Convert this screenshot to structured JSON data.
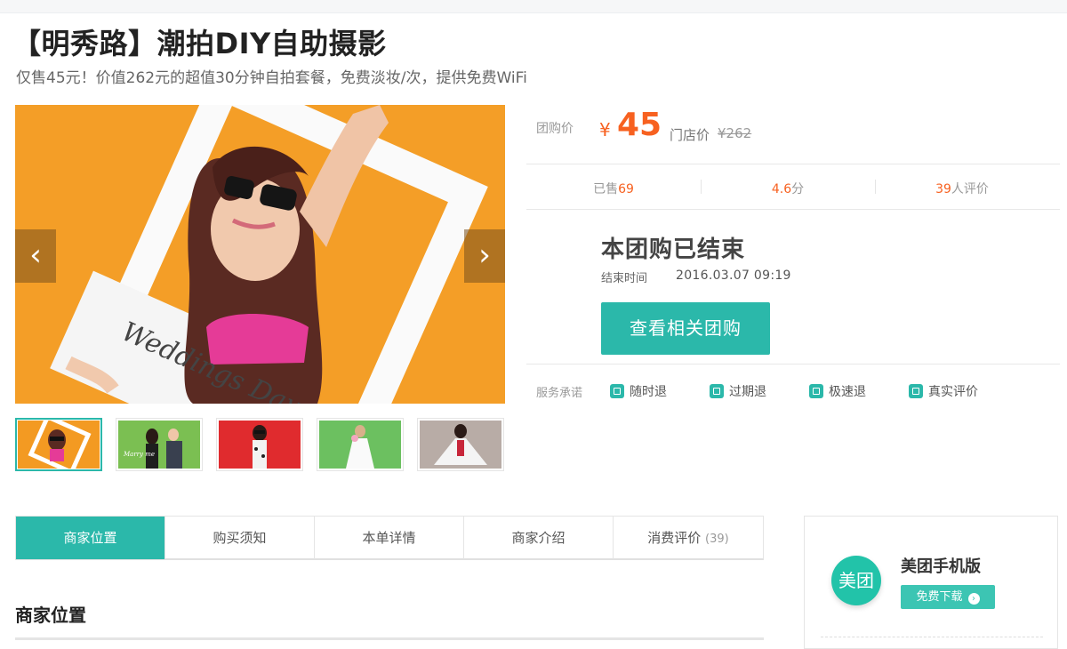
{
  "deal": {
    "title": "【明秀路】潮拍DIY自助摄影",
    "subtitle": "仅售45元！价值262元的超值30分钟自拍套餐，免费淡妆/次，提供免费WiFi"
  },
  "gallery": {
    "photo_text": "Weddings Day",
    "prev_glyph": "‹",
    "next_glyph": "›",
    "thumbnails": [
      {
        "caption": "",
        "active": true
      },
      {
        "caption": "Marry me",
        "active": false
      },
      {
        "caption": "",
        "active": false
      },
      {
        "caption": "",
        "active": false
      },
      {
        "caption": "",
        "active": false
      }
    ]
  },
  "price": {
    "label": "团购价",
    "currency": "¥",
    "value": "45",
    "store_label": "门店价",
    "store_price": "¥262"
  },
  "stats": {
    "sold_label": "已售",
    "sold_value": "69",
    "rating_value": "4.6",
    "rating_unit": "分",
    "reviews_value": "39",
    "reviews_label": "人评价"
  },
  "status": {
    "ended_text": "本团购已结束",
    "end_time_label": "结束时间",
    "end_time_value": "2016.03.07   09:19",
    "related_button": "查看相关团购"
  },
  "service": {
    "label": "服务承诺",
    "items": [
      "随时退",
      "过期退",
      "极速退",
      "真实评价"
    ]
  },
  "tabs": [
    {
      "label": "商家位置",
      "count": "",
      "active": true
    },
    {
      "label": "购买须知",
      "count": "",
      "active": false
    },
    {
      "label": "本单详情",
      "count": "",
      "active": false
    },
    {
      "label": "商家介绍",
      "count": "",
      "active": false
    },
    {
      "label": "消费评价",
      "count": "(39)",
      "active": false
    }
  ],
  "section": {
    "title": "商家位置"
  },
  "app": {
    "logo_text": "美团",
    "name": "美团手机版",
    "download_label": "免费下载",
    "download_arrow": "›"
  },
  "colors": {
    "accent": "#2bb8aa",
    "price": "#f76120"
  }
}
